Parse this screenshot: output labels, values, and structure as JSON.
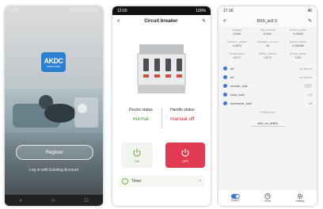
{
  "p1": {
    "status_time": "12:00",
    "status_right": "5G 100% 12:00",
    "logo_text": "AKDC",
    "logo_sub": "SMART HOME",
    "register_label": "Register",
    "login_label": "Log in with Existing Account"
  },
  "p2": {
    "status_time": "12:00",
    "status_right": "100%",
    "back_glyph": "<",
    "title": "Circuit breaker",
    "edit_glyph": "✎",
    "device_status_label": "Device status",
    "device_status_value": "normal",
    "handle_status_label": "Handle status",
    "handle_status_value": "manual off",
    "on_label": "ON",
    "off_label": "OFF",
    "timer_label": "Timer",
    "chev": ">",
    "colors": {
      "normal": "#3a9a35",
      "manual_off": "#d61f2c",
      "off_button": "#e23b51",
      "on_icon": "#7bb04c"
    }
  },
  "p3": {
    "status_time": "17:16",
    "status_right": "46",
    "back_glyph": "<",
    "title": "RXX_sc0 3",
    "edit_glyph": "✎",
    "metrics": [
      {
        "k": "Voltage",
        "v": "220W"
      },
      {
        "k": "Volt_current",
        "v": "0.00A"
      },
      {
        "k": "active_power",
        "v": "0.00kW"
      },
      {
        "k": "reactive_power",
        "v": "0.00W"
      },
      {
        "k": "leakage_current",
        "v": "0A"
      },
      {
        "k": "power_factor",
        "v": "0.00kWh"
      },
      {
        "k": "Temperature",
        "v": "+22°C"
      },
      {
        "k": "active_current",
        "v": "+22°C"
      },
      {
        "k": "power_factor",
        "v": "0.00"
      }
    ],
    "rows": [
      {
        "name": "a/t",
        "right": "no alarm"
      },
      {
        "name": "h/t",
        "right": "no alarm"
      },
      {
        "name": "remote_lock",
        "right": ""
      },
      {
        "name": "local_lock",
        "right": "off"
      },
      {
        "name": "overhaule_lock",
        "right": "off"
      }
    ],
    "select_label": "Protect level",
    "select_value": "auto_on_select",
    "tab_labels": [
      "Switch",
      "Timer",
      "Setting"
    ]
  }
}
